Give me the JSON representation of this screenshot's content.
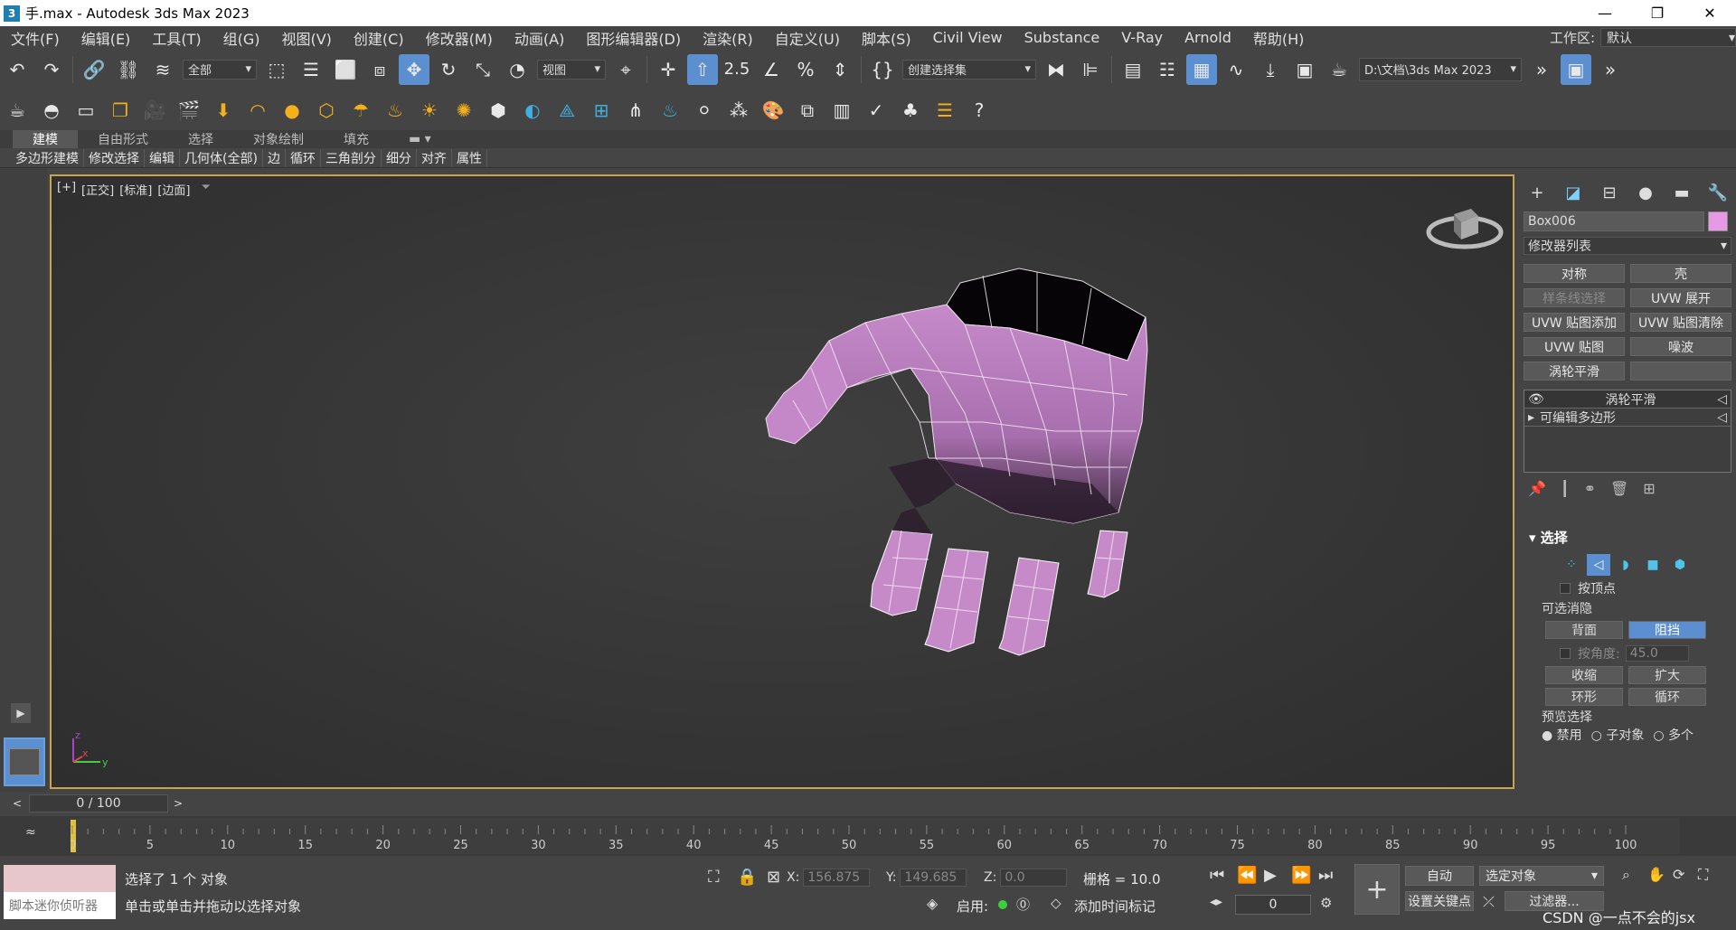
{
  "window": {
    "app_icon": "3",
    "title": "手.max - Autodesk 3ds Max 2023",
    "minimize": "—",
    "restore": "❐",
    "close": "✕"
  },
  "menu": {
    "items": [
      "文件(F)",
      "编辑(E)",
      "工具(T)",
      "组(G)",
      "视图(V)",
      "创建(C)",
      "修改器(M)",
      "动画(A)",
      "图形编辑器(D)",
      "渲染(R)",
      "自定义(U)",
      "脚本(S)",
      "Civil View",
      "Substance",
      "V-Ray",
      "Arnold",
      "帮助(H)"
    ],
    "workspace_label": "工作区:",
    "workspace_value": "默认"
  },
  "toolbar1": {
    "filter_value": "全部",
    "refcoord_value": "视图",
    "snap_label": "2.5",
    "named_selection": "创建选择集",
    "project_path": "D:\\文档\\3ds Max 2023"
  },
  "ribbon": {
    "tabs": [
      "建模",
      "自由形式",
      "选择",
      "对象绘制",
      "填充"
    ],
    "subtabs": [
      "多边形建模",
      "修改选择",
      "编辑",
      "几何体(全部)",
      "边",
      "循环",
      "三角剖分",
      "细分",
      "对齐",
      "属性"
    ]
  },
  "viewport": {
    "label_plus": "[+]",
    "label_view": "[正交]",
    "label_shading1": "[标准]",
    "label_shading2": "[边面]",
    "axis_x": "x",
    "axis_y": "y",
    "axis_z": "z"
  },
  "command_panel": {
    "object_name": "Box006",
    "object_color": "#e69ae6",
    "modifier_list": "修改器列表",
    "buttons": [
      {
        "label": "对称",
        "disabled": false
      },
      {
        "label": "壳",
        "disabled": false
      },
      {
        "label": "样条线选择",
        "disabled": true
      },
      {
        "label": "UVW 展开",
        "disabled": false
      },
      {
        "label": "UVW 贴图添加",
        "disabled": false
      },
      {
        "label": "UVW 贴图清除",
        "disabled": false
      },
      {
        "label": "UVW 贴图",
        "disabled": false
      },
      {
        "label": "噪波",
        "disabled": false
      },
      {
        "label": "涡轮平滑",
        "disabled": false
      },
      {
        "label": "",
        "disabled": false
      }
    ],
    "stack": [
      "涡轮平滑",
      "可编辑多边形"
    ],
    "selection": {
      "title": "选择",
      "by_vertex": "按顶点",
      "backface_group": "可选消隐",
      "backface": "背面",
      "occluded": "阻挡",
      "by_angle": "按角度:",
      "angle_value": "45.0",
      "shrink": "收缩",
      "grow": "扩大",
      "ring": "环形",
      "loop": "循环",
      "preview_group": "预览选择",
      "preview_disabled": "禁用",
      "preview_subobj": "子对象",
      "preview_multi": "多个"
    }
  },
  "timeline": {
    "frame_display": "0 / 100",
    "ticks": [
      "0",
      "5",
      "10",
      "15",
      "20",
      "25",
      "30",
      "35",
      "40",
      "45",
      "50",
      "55",
      "60",
      "65",
      "70",
      "75",
      "80",
      "85",
      "90",
      "95",
      "100"
    ]
  },
  "status": {
    "maxscript_hint": "脚本迷你侦听器",
    "selected_text": "选择了 1 个 对象",
    "prompt_text": "单击或单击并拖动以选择对象",
    "x_label": "X:",
    "x_value": "156.875",
    "y_label": "Y:",
    "y_value": "149.685",
    "z_label": "Z:",
    "z_value": "0.0",
    "grid_text": "栅格 = 10.0",
    "enable_label": "启用:",
    "add_time_tag": "添加时间标记",
    "auto_key": "自动",
    "set_key": "设置关键点",
    "key_filter_dropdown": "选定对象",
    "filters": "过滤器...",
    "frame_value": "0",
    "watermark": "CSDN @一点不会的jsx"
  }
}
